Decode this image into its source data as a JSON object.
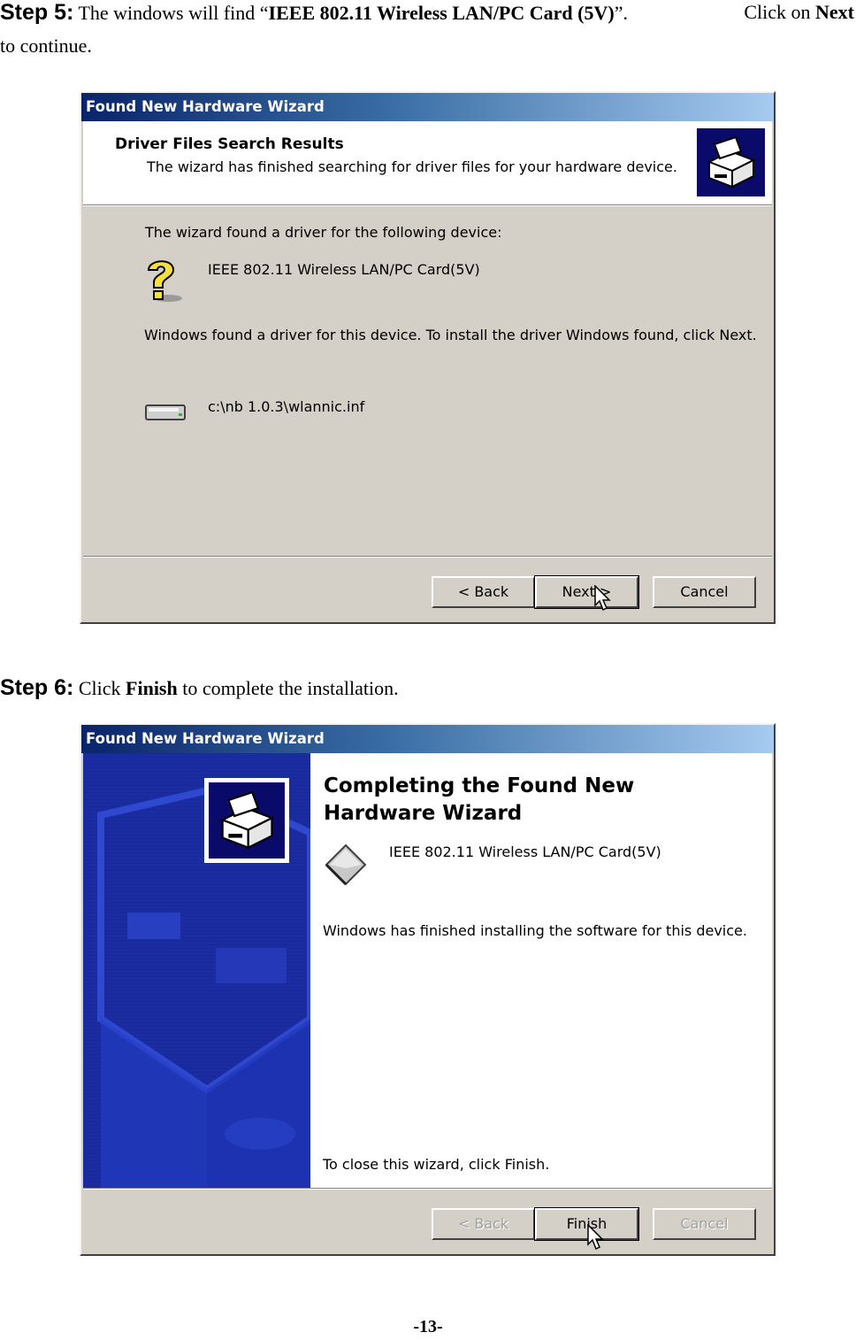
{
  "step5": {
    "label": "Step 5:",
    "text_before": " The windows will find “",
    "device_bold": "IEEE 802.11 Wireless LAN/PC Card (5V)",
    "text_after": "”.",
    "click_on": "Click  on ",
    "next_bold": "Next",
    "line2": "to continue."
  },
  "step6": {
    "label": "Step 6:",
    "click": " Click ",
    "finish_bold": "Finish",
    "rest": " to complete the installation."
  },
  "wizard1": {
    "title": "Found New Hardware Wizard",
    "header_title": "Driver Files Search Results",
    "header_subtitle": "The wizard has finished searching for driver files for your hardware device.",
    "found_text": "The wizard found a driver for the following device:",
    "device_name": "IEEE 802.11 Wireless LAN/PC Card(5V)",
    "instruction": "Windows found a driver for this device. To install the driver Windows found, click Next.",
    "driver_path": "c:\\nb 1.0.3\\wlannic.inf",
    "buttons": {
      "back": "< Back",
      "next": "Next >",
      "cancel": "Cancel"
    }
  },
  "wizard2": {
    "title": "Found New Hardware Wizard",
    "heading": "Completing the Found New Hardware Wizard",
    "device_name": "IEEE 802.11 Wireless LAN/PC Card(5V)",
    "status": "Windows has finished installing the software for this device.",
    "close_hint": "To close this wizard, click Finish.",
    "buttons": {
      "back": "< Back",
      "finish": "Finish",
      "cancel": "Cancel"
    }
  },
  "page_number": "-13-",
  "icons": [
    "hardware-icon",
    "question-icon",
    "drive-icon",
    "pointer-cursor-icon",
    "device-diamond-icon"
  ]
}
